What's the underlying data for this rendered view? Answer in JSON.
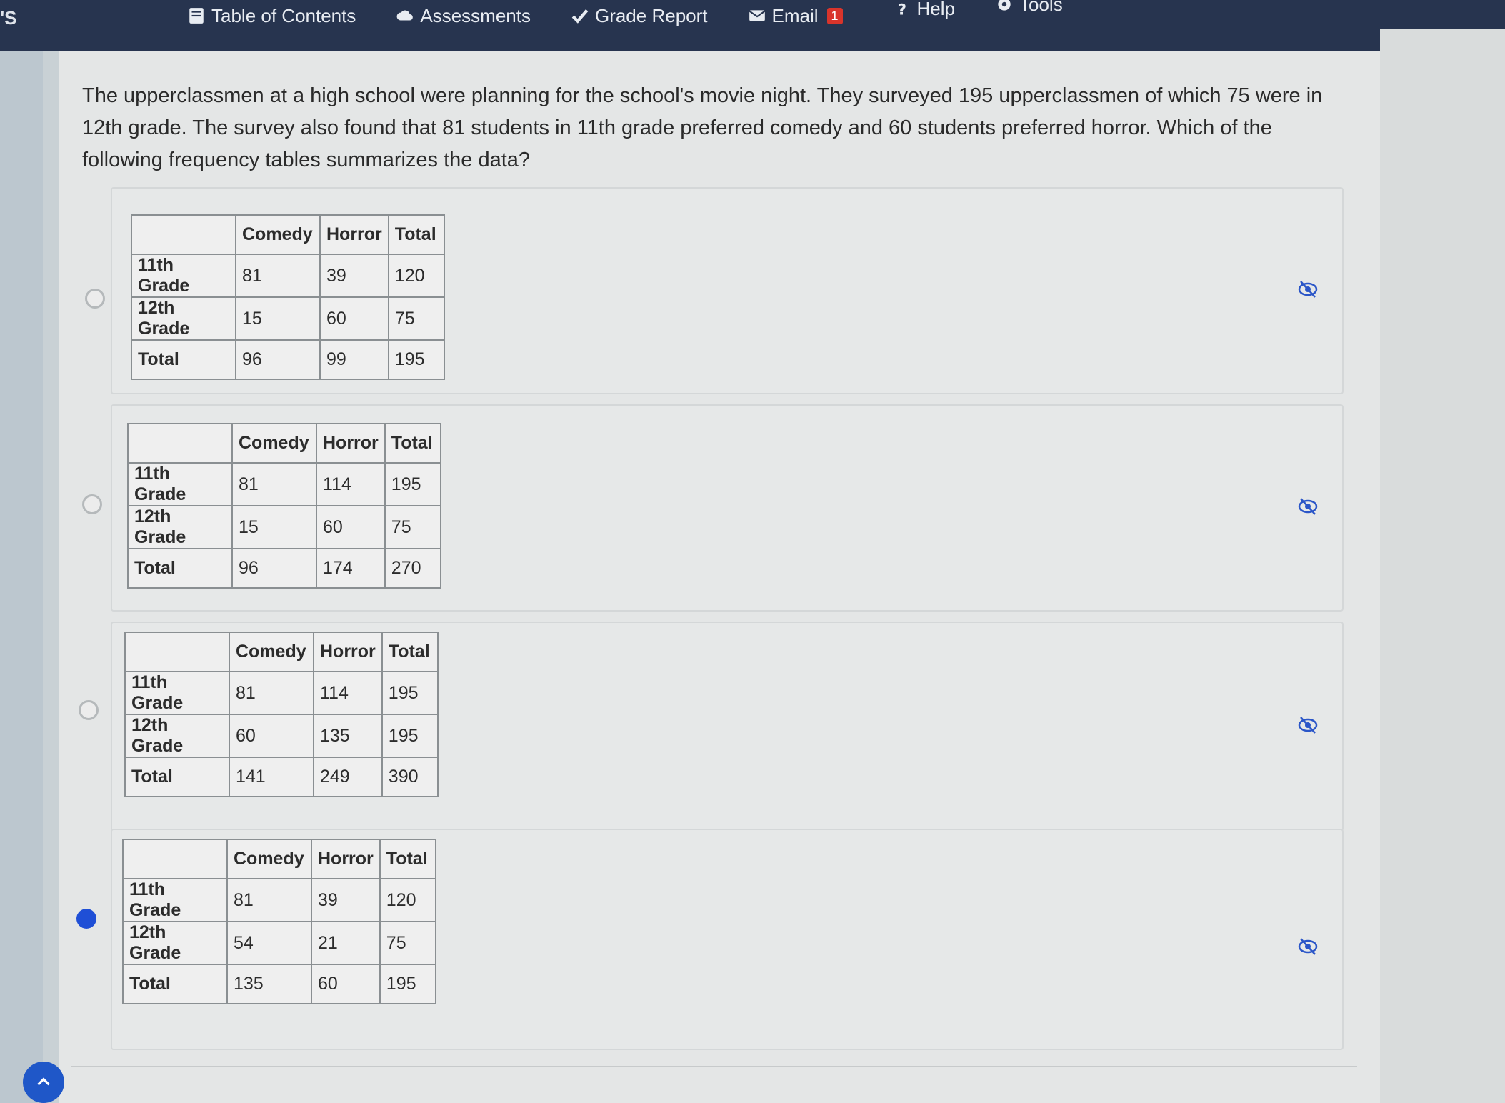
{
  "header": {
    "brand_fragment": "'S",
    "nav": [
      {
        "label": "Table of Contents",
        "icon": "book-icon"
      },
      {
        "label": "Assessments",
        "icon": "cloud-icon"
      },
      {
        "label": "Grade Report",
        "icon": "checkmark-icon"
      },
      {
        "label": "Email",
        "icon": "envelope-icon",
        "badge": "1"
      },
      {
        "label": "Help",
        "icon": "question-icon"
      },
      {
        "label": "Tools",
        "icon": "gear-icon"
      }
    ]
  },
  "question": {
    "text": "The upperclassmen at a high school were planning for the school's movie night. They surveyed 195 upperclassmen of which 75 were in 12th grade. The survey also found that 81 students in 11th grade preferred comedy and 60 students preferred horror. Which of the following frequency tables summarizes the data?"
  },
  "table_headers": [
    "",
    "Comedy",
    "Horror",
    "Total"
  ],
  "options": [
    {
      "selected": false,
      "rows": [
        [
          "11th Grade",
          "81",
          "39",
          "120"
        ],
        [
          "12th Grade",
          "15",
          "60",
          "75"
        ],
        [
          "Total",
          "96",
          "99",
          "195"
        ]
      ]
    },
    {
      "selected": false,
      "rows": [
        [
          "11th Grade",
          "81",
          "114",
          "195"
        ],
        [
          "12th Grade",
          "15",
          "60",
          "75"
        ],
        [
          "Total",
          "96",
          "174",
          "270"
        ]
      ]
    },
    {
      "selected": false,
      "rows": [
        [
          "11th Grade",
          "81",
          "114",
          "195"
        ],
        [
          "12th Grade",
          "60",
          "135",
          "195"
        ],
        [
          "Total",
          "141",
          "249",
          "390"
        ]
      ]
    },
    {
      "selected": true,
      "rows": [
        [
          "11th Grade",
          "81",
          "39",
          "120"
        ],
        [
          "12th Grade",
          "54",
          "21",
          "75"
        ],
        [
          "Total",
          "135",
          "60",
          "195"
        ]
      ]
    }
  ],
  "colors": {
    "topbar": "#27344f",
    "selected_radio": "#1f4fd6",
    "eye_icon": "#2b56c8"
  }
}
